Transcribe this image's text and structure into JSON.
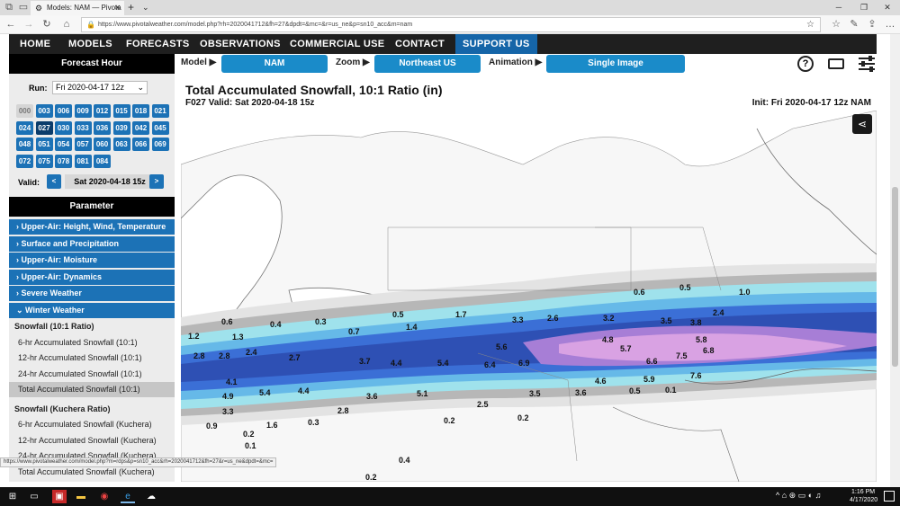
{
  "browser": {
    "tab_title": "Models: NAM — Pivota",
    "url": "https://www.pivotalweather.com/model.php?rh=2020041712&fh=27&dpdt=&mc=&r=us_ne&p=sn10_acc&m=nam",
    "status_url": "https://www.pivotalweather.com/model.php?m=rdps&p=sn10_acc&rh=2020041712&fh=27&r=us_ne&dpdt=&mc="
  },
  "site_nav": [
    "HOME",
    "MODELS",
    "FORECASTS",
    "OBSERVATIONS",
    "COMMERCIAL USE",
    "CONTACT",
    "SUPPORT US"
  ],
  "toolbar": {
    "model_label": "Model ▶",
    "model_value": "NAM",
    "zoom_label": "Zoom ▶",
    "zoom_value": "Northeast US",
    "animation_label": "Animation ▶",
    "animation_value": "Single Image"
  },
  "sidebar": {
    "forecast_hour_title": "Forecast Hour",
    "run_label": "Run:",
    "run_value": "Fri 2020-04-17 12z",
    "hours": [
      "000",
      "003",
      "006",
      "009",
      "012",
      "015",
      "018",
      "021",
      "024",
      "027",
      "030",
      "033",
      "036",
      "039",
      "042",
      "045",
      "048",
      "051",
      "054",
      "057",
      "060",
      "063",
      "066",
      "069",
      "072",
      "075",
      "078",
      "081",
      "084"
    ],
    "valid_label": "Valid:",
    "valid_value": "Sat 2020-04-18 15z",
    "prev": "<",
    "next": ">",
    "parameter_title": "Parameter",
    "parameters": [
      "Upper-Air: Height, Wind, Temperature",
      "Surface and Precipitation",
      "Upper-Air: Moisture",
      "Upper-Air: Dynamics",
      "Severe Weather",
      "Winter Weather"
    ],
    "snowfall_10_title": "Snowfall (10:1 Ratio)",
    "snowfall_10_items": [
      "6-hr Accumulated Snowfall (10:1)",
      "12-hr Accumulated Snowfall (10:1)",
      "24-hr Accumulated Snowfall (10:1)",
      "Total Accumulated Snowfall (10:1)"
    ],
    "snowfall_kuchera_title": "Snowfall (Kuchera Ratio)",
    "snowfall_kuchera_items": [
      "6-hr Accumulated Snowfall (Kuchera)",
      "12-hr Accumulated Snowfall (Kuchera)",
      "24-hr Accumulated Snowfall (Kuchera)",
      "Total Accumulated Snowfall (Kuchera)"
    ]
  },
  "map": {
    "title": "Total Accumulated Snowfall, 10:1 Ratio (in)",
    "subtitle": "F027 Valid: Sat 2020-04-18 15z",
    "init": "Init: Fri 2020-04-17 12z NAM",
    "values": [
      "0.6",
      "0.5",
      "1.0",
      "0.5",
      "1.7",
      "3.3",
      "2.6",
      "3.2",
      "3.5",
      "3.8",
      "2.4",
      "0.6",
      "0.4",
      "0.3",
      "0.7",
      "1.4",
      "1.2",
      "1.3",
      "4.8",
      "5.8",
      "2.8",
      "2.8",
      "2.4",
      "2.7",
      "3.7",
      "4.4",
      "5.4",
      "6.4",
      "6.9",
      "5.6",
      "5.7",
      "6.6",
      "7.5",
      "6.8",
      "7.6",
      "4.6",
      "5.9",
      "4.1",
      "4.9",
      "5.4",
      "4.4",
      "3.6",
      "5.1",
      "3.5",
      "3.6",
      "0.5",
      "0.1",
      "3.3",
      "0.9",
      "1.6",
      "0.3",
      "2.8",
      "2.5",
      "0.2",
      "0.2",
      "0.2",
      "0.1",
      "0.4",
      "0.2"
    ]
  },
  "taskbar": {
    "time": "1:16 PM",
    "date": "4/17/2020"
  }
}
